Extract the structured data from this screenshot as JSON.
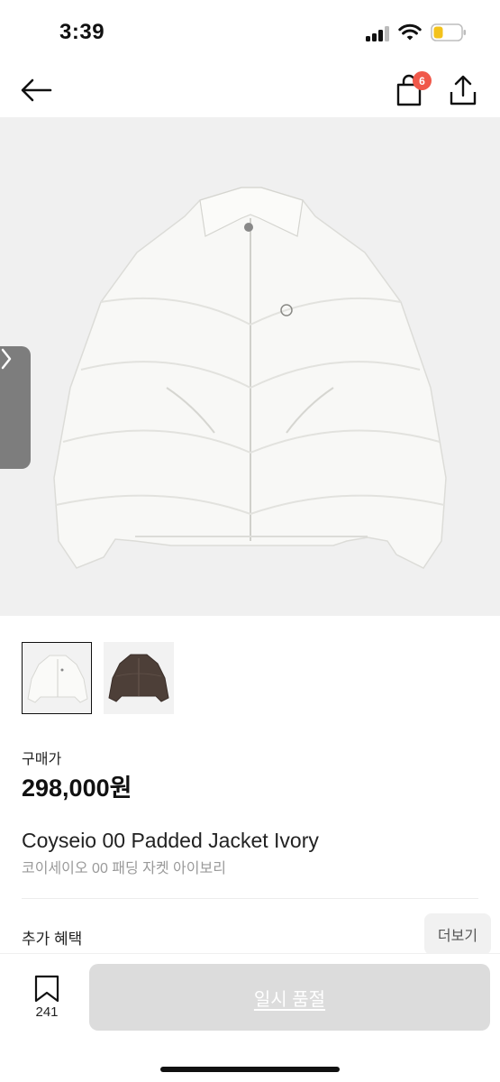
{
  "status": {
    "time": "3:39",
    "icons": [
      "signal-icon",
      "wifi-icon",
      "battery-icon"
    ]
  },
  "nav": {
    "back_icon": "arrow-left-icon",
    "bag_icon": "shopping-bag-icon",
    "bag_badge": "6",
    "share_icon": "share-icon",
    "badge_color": "#f0584a"
  },
  "gallery": {
    "side_tab_icon": "chevron-right-icon",
    "thumbnails": [
      {
        "color": "ivory",
        "selected": true
      },
      {
        "color": "brown",
        "selected": false
      }
    ]
  },
  "product": {
    "price_label": "구매가",
    "price": "298,000원",
    "name": "Coyseio 00 Padded Jacket Ivory",
    "name_ko": "코이세이오 00 패딩 자켓 아이보리"
  },
  "benefits": {
    "title": "추가 혜택",
    "more_label": "더보기"
  },
  "bottom": {
    "bookmark_icon": "bookmark-icon",
    "bookmark_count": "241",
    "soldout_label": "일시 품절"
  }
}
